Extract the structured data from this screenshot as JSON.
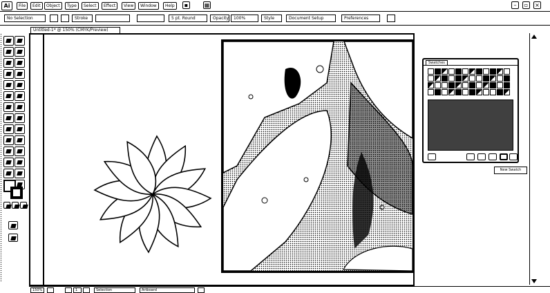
{
  "app": {
    "logo_text": "Ai"
  },
  "menu": {
    "items": [
      "File",
      "Edit",
      "Object",
      "Type",
      "Select",
      "Effect",
      "View",
      "Window",
      "Help"
    ]
  },
  "window_controls": {
    "minimize": "–",
    "maximize": "▫",
    "close": "×"
  },
  "control_bar": {
    "selection_label": "No Selection",
    "stroke_label": "Stroke",
    "brush_value": "5 pt. Round",
    "opacity_label": "Opacity",
    "opacity_value": "100%",
    "style_label": "Style",
    "doc_setup": "Document Setup",
    "preferences": "Preferences"
  },
  "document": {
    "tab_title": "Untitled-1* @ 150% (CMYK/Preview)"
  },
  "swatches_panel": {
    "tab_label": "Swatches",
    "tooltip": "New Swatch"
  },
  "status_bar": {
    "zoom": "150%",
    "page": "1",
    "tool_name": "Selection",
    "artboard_label": "Artboard"
  },
  "icons": [
    "ai-logo",
    "selection-tool-icon",
    "pen-tool-icon",
    "type-tool-icon",
    "brush-tool-icon",
    "fill-stroke-icon",
    "new-swatch-icon",
    "delete-swatch-icon"
  ]
}
